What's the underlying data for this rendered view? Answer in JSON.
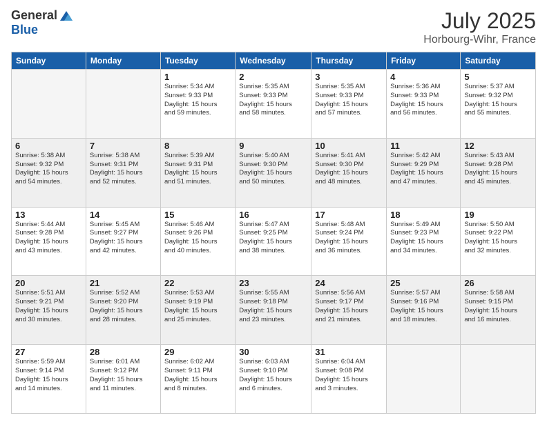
{
  "header": {
    "logo_general": "General",
    "logo_blue": "Blue",
    "month": "July 2025",
    "location": "Horbourg-Wihr, France"
  },
  "days_of_week": [
    "Sunday",
    "Monday",
    "Tuesday",
    "Wednesday",
    "Thursday",
    "Friday",
    "Saturday"
  ],
  "weeks": [
    [
      {
        "day": "",
        "info": ""
      },
      {
        "day": "",
        "info": ""
      },
      {
        "day": "1",
        "info": "Sunrise: 5:34 AM\nSunset: 9:33 PM\nDaylight: 15 hours\nand 59 minutes."
      },
      {
        "day": "2",
        "info": "Sunrise: 5:35 AM\nSunset: 9:33 PM\nDaylight: 15 hours\nand 58 minutes."
      },
      {
        "day": "3",
        "info": "Sunrise: 5:35 AM\nSunset: 9:33 PM\nDaylight: 15 hours\nand 57 minutes."
      },
      {
        "day": "4",
        "info": "Sunrise: 5:36 AM\nSunset: 9:33 PM\nDaylight: 15 hours\nand 56 minutes."
      },
      {
        "day": "5",
        "info": "Sunrise: 5:37 AM\nSunset: 9:32 PM\nDaylight: 15 hours\nand 55 minutes."
      }
    ],
    [
      {
        "day": "6",
        "info": "Sunrise: 5:38 AM\nSunset: 9:32 PM\nDaylight: 15 hours\nand 54 minutes."
      },
      {
        "day": "7",
        "info": "Sunrise: 5:38 AM\nSunset: 9:31 PM\nDaylight: 15 hours\nand 52 minutes."
      },
      {
        "day": "8",
        "info": "Sunrise: 5:39 AM\nSunset: 9:31 PM\nDaylight: 15 hours\nand 51 minutes."
      },
      {
        "day": "9",
        "info": "Sunrise: 5:40 AM\nSunset: 9:30 PM\nDaylight: 15 hours\nand 50 minutes."
      },
      {
        "day": "10",
        "info": "Sunrise: 5:41 AM\nSunset: 9:30 PM\nDaylight: 15 hours\nand 48 minutes."
      },
      {
        "day": "11",
        "info": "Sunrise: 5:42 AM\nSunset: 9:29 PM\nDaylight: 15 hours\nand 47 minutes."
      },
      {
        "day": "12",
        "info": "Sunrise: 5:43 AM\nSunset: 9:28 PM\nDaylight: 15 hours\nand 45 minutes."
      }
    ],
    [
      {
        "day": "13",
        "info": "Sunrise: 5:44 AM\nSunset: 9:28 PM\nDaylight: 15 hours\nand 43 minutes."
      },
      {
        "day": "14",
        "info": "Sunrise: 5:45 AM\nSunset: 9:27 PM\nDaylight: 15 hours\nand 42 minutes."
      },
      {
        "day": "15",
        "info": "Sunrise: 5:46 AM\nSunset: 9:26 PM\nDaylight: 15 hours\nand 40 minutes."
      },
      {
        "day": "16",
        "info": "Sunrise: 5:47 AM\nSunset: 9:25 PM\nDaylight: 15 hours\nand 38 minutes."
      },
      {
        "day": "17",
        "info": "Sunrise: 5:48 AM\nSunset: 9:24 PM\nDaylight: 15 hours\nand 36 minutes."
      },
      {
        "day": "18",
        "info": "Sunrise: 5:49 AM\nSunset: 9:23 PM\nDaylight: 15 hours\nand 34 minutes."
      },
      {
        "day": "19",
        "info": "Sunrise: 5:50 AM\nSunset: 9:22 PM\nDaylight: 15 hours\nand 32 minutes."
      }
    ],
    [
      {
        "day": "20",
        "info": "Sunrise: 5:51 AM\nSunset: 9:21 PM\nDaylight: 15 hours\nand 30 minutes."
      },
      {
        "day": "21",
        "info": "Sunrise: 5:52 AM\nSunset: 9:20 PM\nDaylight: 15 hours\nand 28 minutes."
      },
      {
        "day": "22",
        "info": "Sunrise: 5:53 AM\nSunset: 9:19 PM\nDaylight: 15 hours\nand 25 minutes."
      },
      {
        "day": "23",
        "info": "Sunrise: 5:55 AM\nSunset: 9:18 PM\nDaylight: 15 hours\nand 23 minutes."
      },
      {
        "day": "24",
        "info": "Sunrise: 5:56 AM\nSunset: 9:17 PM\nDaylight: 15 hours\nand 21 minutes."
      },
      {
        "day": "25",
        "info": "Sunrise: 5:57 AM\nSunset: 9:16 PM\nDaylight: 15 hours\nand 18 minutes."
      },
      {
        "day": "26",
        "info": "Sunrise: 5:58 AM\nSunset: 9:15 PM\nDaylight: 15 hours\nand 16 minutes."
      }
    ],
    [
      {
        "day": "27",
        "info": "Sunrise: 5:59 AM\nSunset: 9:14 PM\nDaylight: 15 hours\nand 14 minutes."
      },
      {
        "day": "28",
        "info": "Sunrise: 6:01 AM\nSunset: 9:12 PM\nDaylight: 15 hours\nand 11 minutes."
      },
      {
        "day": "29",
        "info": "Sunrise: 6:02 AM\nSunset: 9:11 PM\nDaylight: 15 hours\nand 8 minutes."
      },
      {
        "day": "30",
        "info": "Sunrise: 6:03 AM\nSunset: 9:10 PM\nDaylight: 15 hours\nand 6 minutes."
      },
      {
        "day": "31",
        "info": "Sunrise: 6:04 AM\nSunset: 9:08 PM\nDaylight: 15 hours\nand 3 minutes."
      },
      {
        "day": "",
        "info": ""
      },
      {
        "day": "",
        "info": ""
      }
    ]
  ]
}
